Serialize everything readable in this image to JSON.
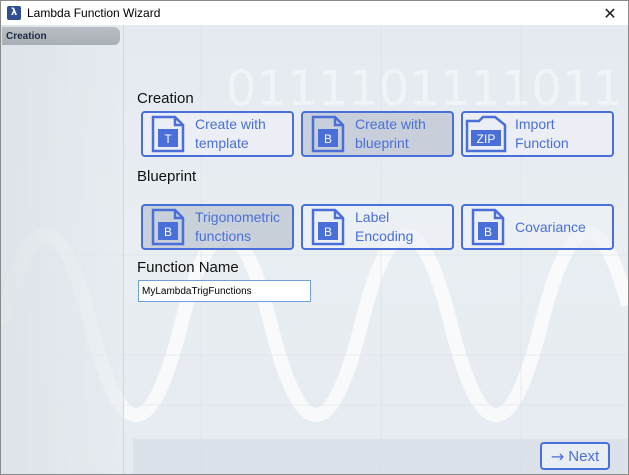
{
  "window": {
    "title": "Lambda Function Wizard",
    "close_glyph": "✕"
  },
  "sidebar": {
    "items": [
      {
        "label": "Creation",
        "selected": true
      }
    ]
  },
  "creation": {
    "heading": "Creation",
    "tiles": [
      {
        "icon_letter": "T",
        "label": "Create with\ntemplate",
        "selected": false
      },
      {
        "icon_letter": "B",
        "label": "Create with\nblueprint",
        "selected": true
      },
      {
        "icon_letter": "ZIP",
        "label": "Import\nFunction",
        "selected": false
      }
    ]
  },
  "blueprint": {
    "heading": "Blueprint",
    "tiles": [
      {
        "icon_letter": "B",
        "label": "Trigonometric\nfunctions",
        "selected": true
      },
      {
        "icon_letter": "B",
        "label": "Label\nEncoding",
        "selected": false
      },
      {
        "icon_letter": "B",
        "label": "Covariance",
        "selected": false
      }
    ]
  },
  "function_name": {
    "heading": "Function Name",
    "value": "MyLambdaTrigFunctions"
  },
  "footer": {
    "next_arrow": "→",
    "next_label": "Next"
  },
  "colors": {
    "accent": "#4a6fd8",
    "selected_tile_bg": "#bec6d2"
  }
}
